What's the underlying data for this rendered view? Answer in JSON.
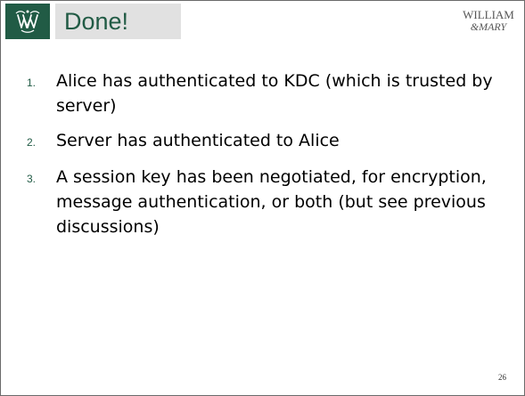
{
  "slide": {
    "title": "Done!",
    "brand": {
      "line1": "WILLIAM",
      "line2": "&MARY"
    },
    "logo_icon": "wm-cypher-icon",
    "items": [
      {
        "number": "1.",
        "text": "Alice has authenticated to KDC (which is trusted by server)"
      },
      {
        "number": "2.",
        "text": "Server has authenticated to Alice"
      },
      {
        "number": "3.",
        "text": "A session key has been negotiated, for encryption, message authentication, or both (but see previous discussions)"
      }
    ],
    "page_number": "26"
  },
  "colors": {
    "green": "#215b45",
    "title_bg": "#e1e1e1",
    "text": "#000000"
  }
}
